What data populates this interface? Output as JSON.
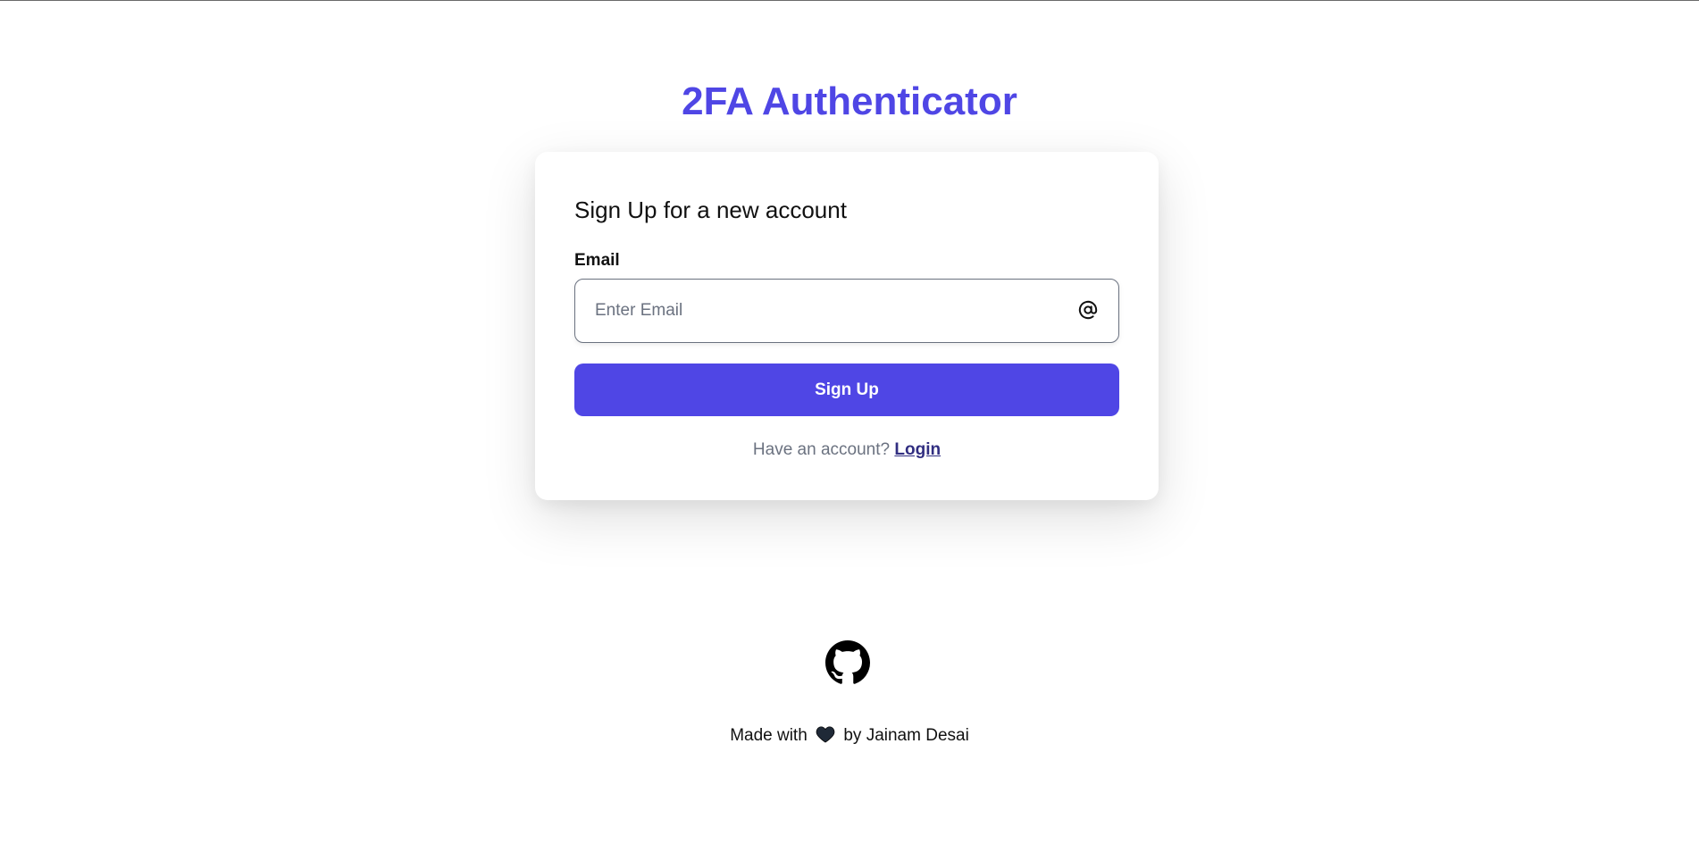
{
  "header": {
    "app_title": "2FA Authenticator"
  },
  "signup_card": {
    "heading": "Sign Up for a new account",
    "email_label": "Email",
    "email_placeholder": "Enter Email",
    "email_value": "",
    "email_icon": "at-sign-icon",
    "submit_label": "Sign Up",
    "login_prompt": "Have an account?",
    "login_link": "Login"
  },
  "footer": {
    "github_icon": "github-icon",
    "made_with": "Made with",
    "heart_icon": "heart-icon",
    "by_author": "by Jainam Desai"
  },
  "colors": {
    "accent": "#4f46e5",
    "link": "#312e81",
    "muted_text": "#6b7280",
    "heart": "#1f2937"
  }
}
